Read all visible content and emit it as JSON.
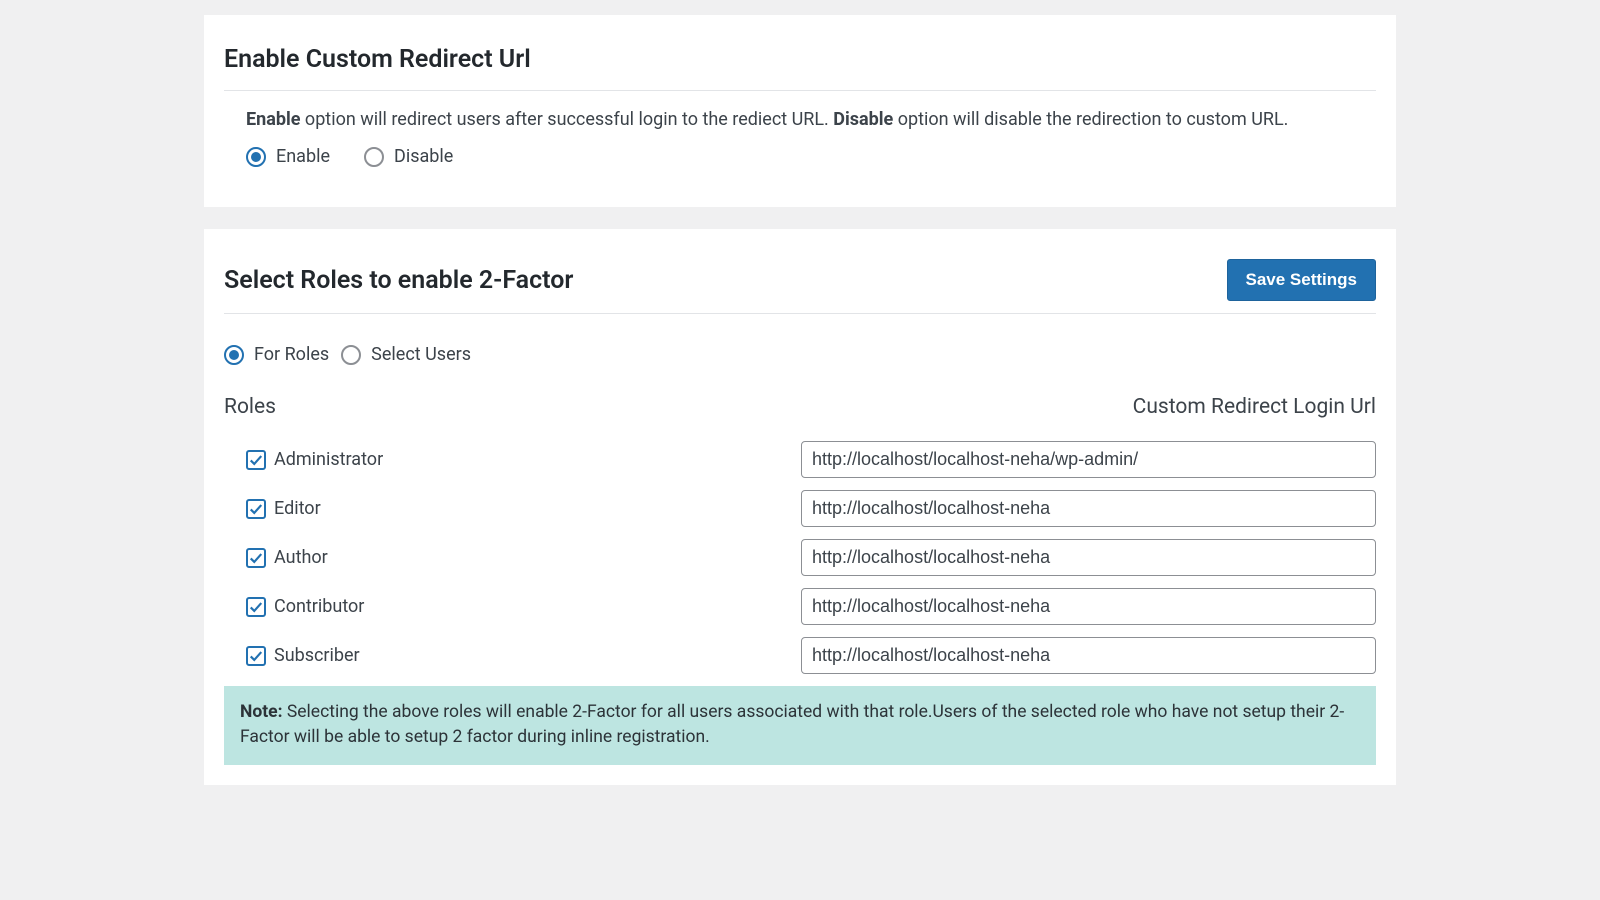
{
  "section1": {
    "title": "Enable Custom Redirect Url",
    "desc_bold1": "Enable",
    "desc_mid": " option will redirect users after successful login to the rediect URL. ",
    "desc_bold2": "Disable",
    "desc_end": " option will disable the redirection to custom URL.",
    "enable_label": "Enable",
    "disable_label": "Disable"
  },
  "section2": {
    "title": "Select Roles to enable 2-Factor",
    "save_button": "Save Settings",
    "mode_for_roles": "For Roles",
    "mode_select_users": "Select Users",
    "col_roles": "Roles",
    "col_url": "Custom Redirect Login Url",
    "roles": [
      {
        "label": "Administrator",
        "url": "http://localhost/localhost-neha/wp-admin/"
      },
      {
        "label": "Editor",
        "url": "http://localhost/localhost-neha"
      },
      {
        "label": "Author",
        "url": "http://localhost/localhost-neha"
      },
      {
        "label": "Contributor",
        "url": "http://localhost/localhost-neha"
      },
      {
        "label": "Subscriber",
        "url": "http://localhost/localhost-neha"
      }
    ],
    "note_bold": "Note:",
    "note_text": " Selecting the above roles will enable 2-Factor for all users associated with that role.Users of the selected role who have not setup their 2-Factor will be able to setup 2 factor during inline registration."
  }
}
